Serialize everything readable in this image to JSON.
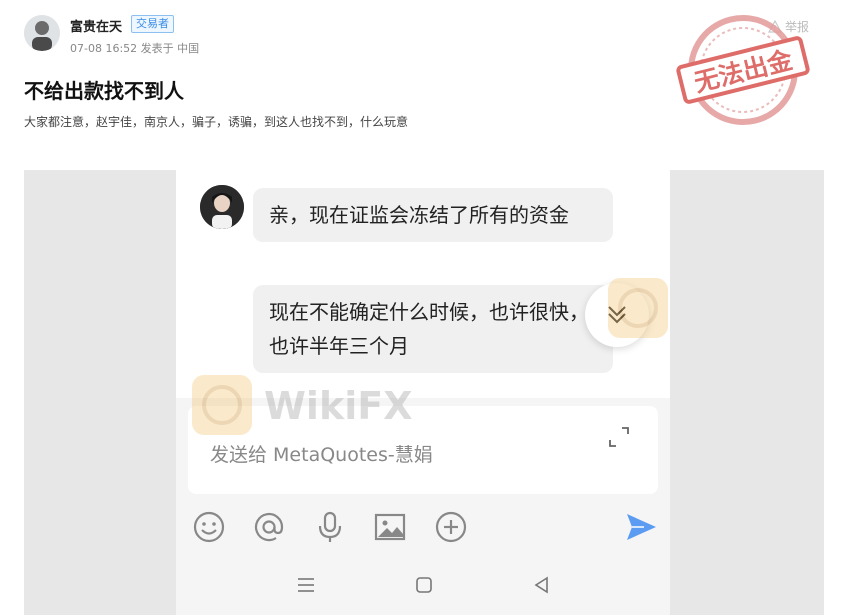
{
  "author": {
    "name": "富贵在天",
    "badge": "交易者",
    "meta": "07-08 16:52 发表于 中国"
  },
  "actions": {
    "report_label": "举报"
  },
  "stamp": {
    "text": "无法出金",
    "color": "#d9534f"
  },
  "post": {
    "title": "不给出款找不到人",
    "body": "大家都注意，赵宇佳，南京人，骗子，诱骗，到这人也找不到，什么玩意"
  },
  "chat": {
    "messages": [
      {
        "text": "亲，现在证监会冻结了所有的资金"
      },
      {
        "text": "现在不能确定什么时候，也许很快，也许半年三个月"
      }
    ],
    "input_placeholder": "发送给 MetaQuotes-慧娟"
  },
  "watermark": {
    "text": "WikiFX"
  },
  "colors": {
    "accent": "#3a8ee6",
    "send": "#5b9cf2",
    "bubble": "#f0f0f0"
  }
}
